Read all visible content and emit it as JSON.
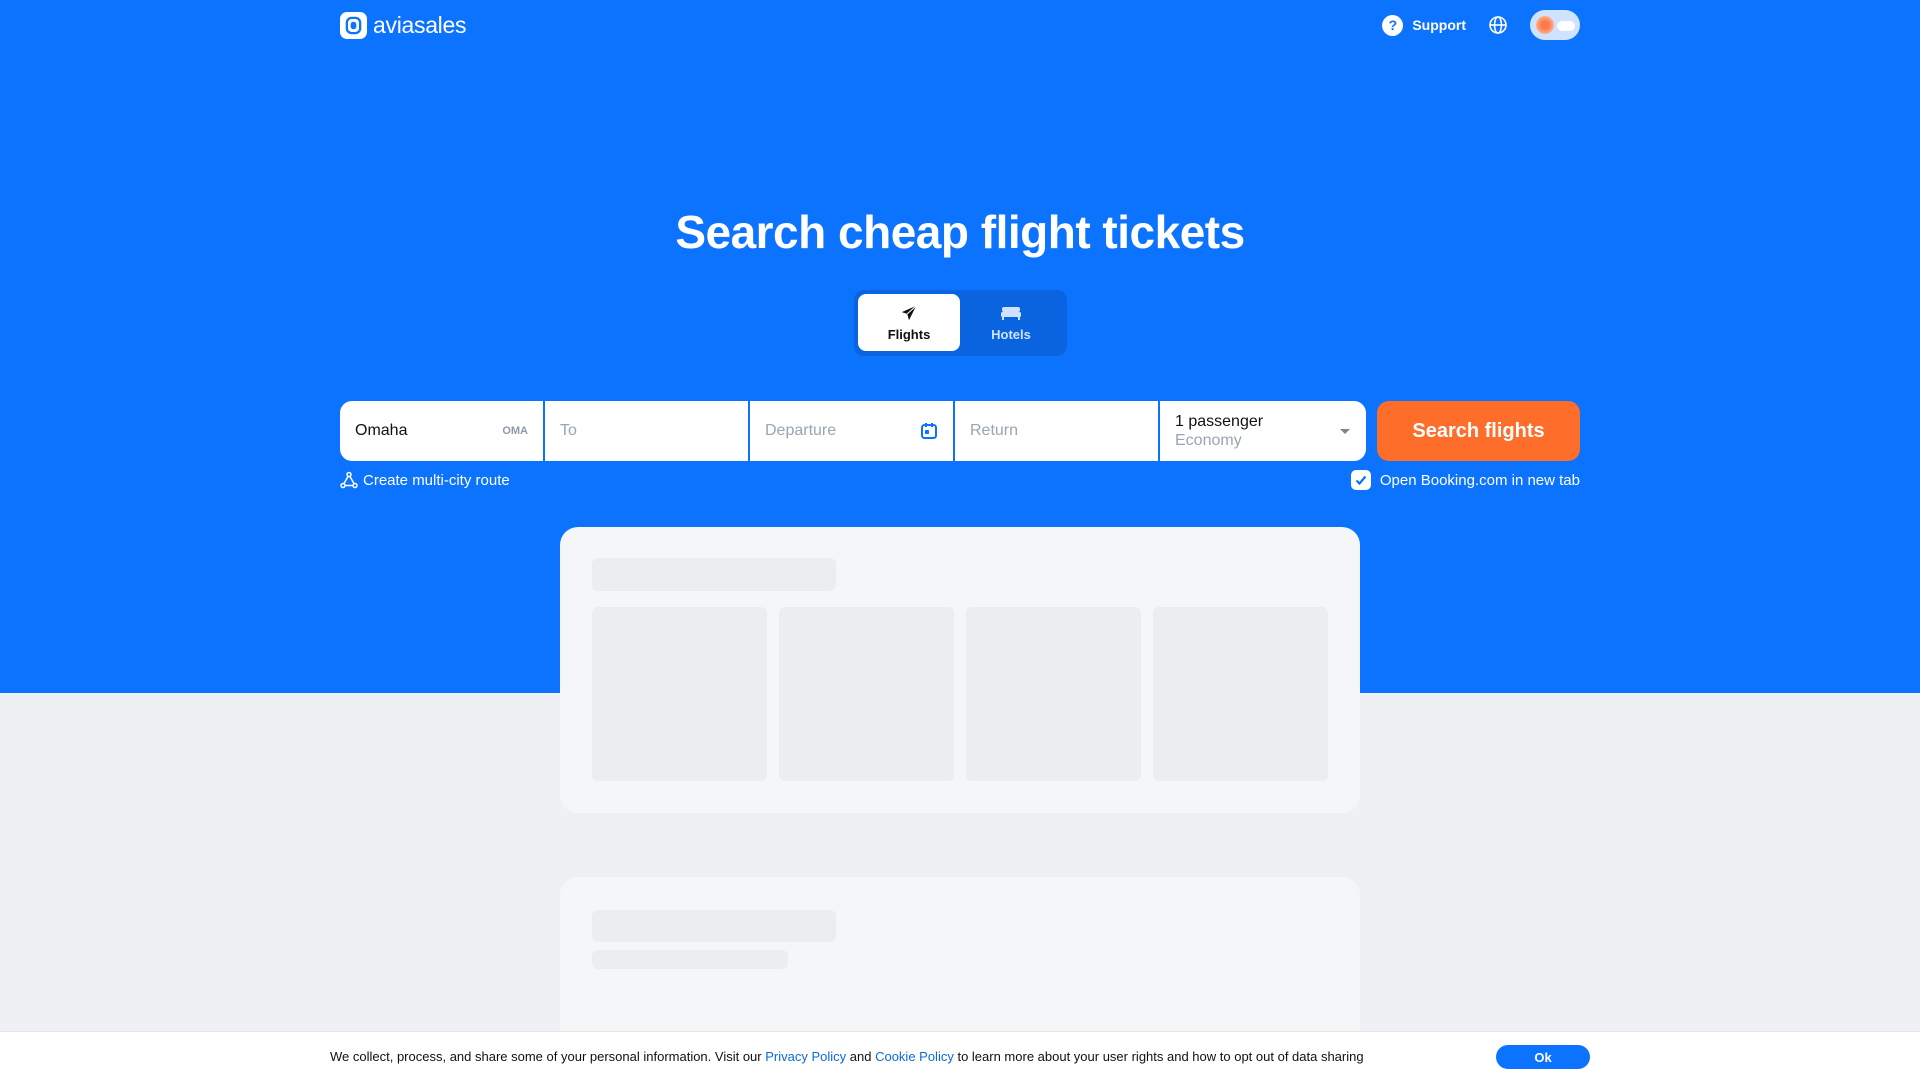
{
  "header": {
    "logo_text": "aviasales",
    "support_label": "Support",
    "support_icon": "question-icon",
    "language_icon": "globe-icon",
    "theme_toggle_icon": "sun-cloud-toggle"
  },
  "hero": {
    "title": "Search cheap flight tickets",
    "background_color": "#0c73fe"
  },
  "tabs": [
    {
      "label": "Flights",
      "icon": "plane-icon",
      "active": true
    },
    {
      "label": "Hotels",
      "icon": "bed-icon",
      "active": false
    }
  ],
  "search": {
    "origin_value": "Omaha",
    "origin_iata": "OMA",
    "destination_placeholder": "To",
    "departure_placeholder": "Departure",
    "return_placeholder": "Return",
    "passengers": "1 passenger",
    "cabin_class": "Economy",
    "search_button": "Search flights",
    "search_button_color": "#ff6d2b"
  },
  "options": {
    "multi_city": "Create multi-city route",
    "booking_new_tab": "Open Booking.com in new tab",
    "booking_new_tab_checked": true
  },
  "cookie": {
    "text_before": "We collect, process, and share some of your personal information. Visit our ",
    "privacy_link": "Privacy Policy",
    "text_and": " and ",
    "cookie_link": "Cookie Policy",
    "text_after": " to learn more about your user rights and how to opt out of data sharing",
    "ok_button": "Ok"
  }
}
